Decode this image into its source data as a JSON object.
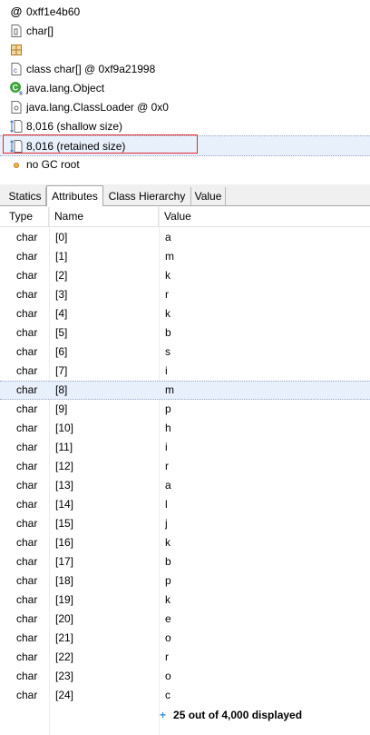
{
  "details": {
    "address": "0xff1e4b60",
    "type_name": "char[]",
    "class_line": "class char[] @ 0xf9a21998",
    "superclass": "java.lang.Object",
    "classloader": "java.lang.ClassLoader @ 0x0",
    "shallow_size": "8,016 (shallow size)",
    "retained_size": "8,016 (retained size)",
    "gc_root": "no GC root"
  },
  "tabs": [
    {
      "label": "Statics"
    },
    {
      "label": "Attributes"
    },
    {
      "label": "Class Hierarchy"
    },
    {
      "label": "Value"
    }
  ],
  "active_tab": "Attributes",
  "table": {
    "headers": [
      "Type",
      "Name",
      "Value"
    ],
    "rows": [
      {
        "type": "char",
        "name": "[0]",
        "value": "a"
      },
      {
        "type": "char",
        "name": "[1]",
        "value": "m"
      },
      {
        "type": "char",
        "name": "[2]",
        "value": "k"
      },
      {
        "type": "char",
        "name": "[3]",
        "value": "r"
      },
      {
        "type": "char",
        "name": "[4]",
        "value": "k"
      },
      {
        "type": "char",
        "name": "[5]",
        "value": "b"
      },
      {
        "type": "char",
        "name": "[6]",
        "value": "s"
      },
      {
        "type": "char",
        "name": "[7]",
        "value": "i"
      },
      {
        "type": "char",
        "name": "[8]",
        "value": "m"
      },
      {
        "type": "char",
        "name": "[9]",
        "value": "p"
      },
      {
        "type": "char",
        "name": "[10]",
        "value": "h"
      },
      {
        "type": "char",
        "name": "[11]",
        "value": "i"
      },
      {
        "type": "char",
        "name": "[12]",
        "value": "r"
      },
      {
        "type": "char",
        "name": "[13]",
        "value": "a"
      },
      {
        "type": "char",
        "name": "[14]",
        "value": "l"
      },
      {
        "type": "char",
        "name": "[15]",
        "value": "j"
      },
      {
        "type": "char",
        "name": "[16]",
        "value": "k"
      },
      {
        "type": "char",
        "name": "[17]",
        "value": "b"
      },
      {
        "type": "char",
        "name": "[18]",
        "value": "p"
      },
      {
        "type": "char",
        "name": "[19]",
        "value": "k"
      },
      {
        "type": "char",
        "name": "[20]",
        "value": "e"
      },
      {
        "type": "char",
        "name": "[21]",
        "value": "o"
      },
      {
        "type": "char",
        "name": "[22]",
        "value": "r"
      },
      {
        "type": "char",
        "name": "[23]",
        "value": "o"
      },
      {
        "type": "char",
        "name": "[24]",
        "value": "c"
      }
    ],
    "highlighted_row": 8,
    "footer": "25 out of 4,000 displayed"
  },
  "colors": {
    "selection": "#e8f0fc",
    "highlight_border": "#e0292f",
    "expand_plus": "#3a8fd8"
  }
}
